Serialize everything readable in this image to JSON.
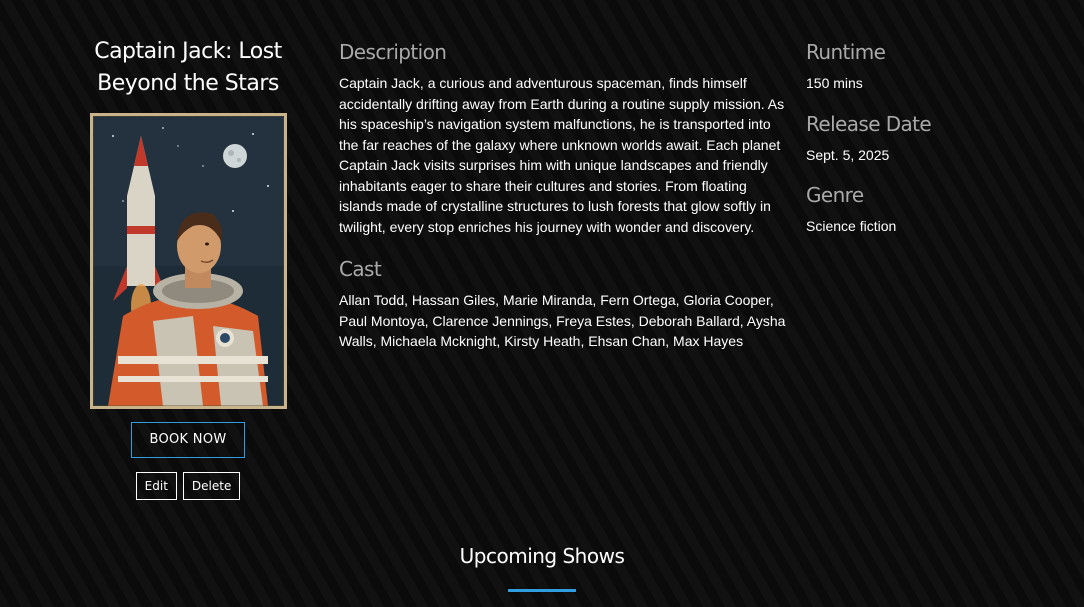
{
  "movie": {
    "title": "Captain Jack: Lost Beyond the Stars",
    "book_label": "BOOK NOW",
    "edit_label": "Edit",
    "delete_label": "Delete"
  },
  "description": {
    "heading": "Description",
    "text": "Captain Jack, a curious and adventurous spaceman, finds himself accidentally drifting away from Earth during a routine supply mission. As his spaceship’s navigation system malfunctions, he is transported into the far reaches of the galaxy where unknown worlds await. Each planet Captain Jack visits surprises him with unique landscapes and friendly inhabitants eager to share their cultures and stories. From floating islands made of crystalline structures to lush forests that glow softly in twilight, every stop enriches his journey with wonder and discovery."
  },
  "cast": {
    "heading": "Cast",
    "text": "Allan Todd, Hassan Giles, Marie Miranda, Fern Ortega, Gloria Cooper, Paul Montoya, Clarence Jennings, Freya Estes, Deborah Ballard, Aysha Walls, Michaela Mcknight, Kirsty Heath, Ehsan Chan, Max Hayes"
  },
  "runtime": {
    "heading": "Runtime",
    "value": "150 mins"
  },
  "release_date": {
    "heading": "Release Date",
    "value": "Sept. 5, 2025"
  },
  "genre": {
    "heading": "Genre",
    "value": "Science fiction"
  },
  "upcoming": {
    "title": "Upcoming Shows"
  },
  "colors": {
    "accent": "#2f9ee0",
    "background": "#0b0b0b",
    "heading_gray": "#a9a9a9"
  }
}
